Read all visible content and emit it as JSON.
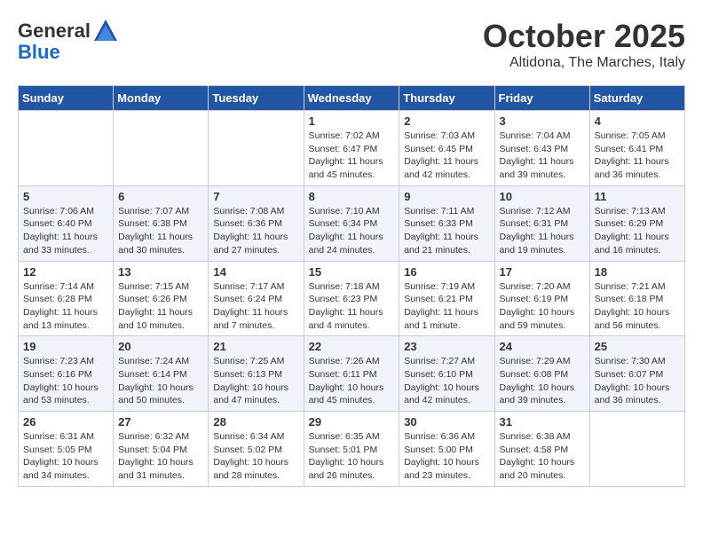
{
  "logo": {
    "general": "General",
    "blue": "Blue"
  },
  "header": {
    "month_year": "October 2025",
    "location": "Altidona, The Marches, Italy"
  },
  "days_of_week": [
    "Sunday",
    "Monday",
    "Tuesday",
    "Wednesday",
    "Thursday",
    "Friday",
    "Saturday"
  ],
  "weeks": [
    [
      {
        "day": "",
        "info": ""
      },
      {
        "day": "",
        "info": ""
      },
      {
        "day": "",
        "info": ""
      },
      {
        "day": "1",
        "info": "Sunrise: 7:02 AM\nSunset: 6:47 PM\nDaylight: 11 hours and 45 minutes."
      },
      {
        "day": "2",
        "info": "Sunrise: 7:03 AM\nSunset: 6:45 PM\nDaylight: 11 hours and 42 minutes."
      },
      {
        "day": "3",
        "info": "Sunrise: 7:04 AM\nSunset: 6:43 PM\nDaylight: 11 hours and 39 minutes."
      },
      {
        "day": "4",
        "info": "Sunrise: 7:05 AM\nSunset: 6:41 PM\nDaylight: 11 hours and 36 minutes."
      }
    ],
    [
      {
        "day": "5",
        "info": "Sunrise: 7:06 AM\nSunset: 6:40 PM\nDaylight: 11 hours and 33 minutes."
      },
      {
        "day": "6",
        "info": "Sunrise: 7:07 AM\nSunset: 6:38 PM\nDaylight: 11 hours and 30 minutes."
      },
      {
        "day": "7",
        "info": "Sunrise: 7:08 AM\nSunset: 6:36 PM\nDaylight: 11 hours and 27 minutes."
      },
      {
        "day": "8",
        "info": "Sunrise: 7:10 AM\nSunset: 6:34 PM\nDaylight: 11 hours and 24 minutes."
      },
      {
        "day": "9",
        "info": "Sunrise: 7:11 AM\nSunset: 6:33 PM\nDaylight: 11 hours and 21 minutes."
      },
      {
        "day": "10",
        "info": "Sunrise: 7:12 AM\nSunset: 6:31 PM\nDaylight: 11 hours and 19 minutes."
      },
      {
        "day": "11",
        "info": "Sunrise: 7:13 AM\nSunset: 6:29 PM\nDaylight: 11 hours and 16 minutes."
      }
    ],
    [
      {
        "day": "12",
        "info": "Sunrise: 7:14 AM\nSunset: 6:28 PM\nDaylight: 11 hours and 13 minutes."
      },
      {
        "day": "13",
        "info": "Sunrise: 7:15 AM\nSunset: 6:26 PM\nDaylight: 11 hours and 10 minutes."
      },
      {
        "day": "14",
        "info": "Sunrise: 7:17 AM\nSunset: 6:24 PM\nDaylight: 11 hours and 7 minutes."
      },
      {
        "day": "15",
        "info": "Sunrise: 7:18 AM\nSunset: 6:23 PM\nDaylight: 11 hours and 4 minutes."
      },
      {
        "day": "16",
        "info": "Sunrise: 7:19 AM\nSunset: 6:21 PM\nDaylight: 11 hours and 1 minute."
      },
      {
        "day": "17",
        "info": "Sunrise: 7:20 AM\nSunset: 6:19 PM\nDaylight: 10 hours and 59 minutes."
      },
      {
        "day": "18",
        "info": "Sunrise: 7:21 AM\nSunset: 6:18 PM\nDaylight: 10 hours and 56 minutes."
      }
    ],
    [
      {
        "day": "19",
        "info": "Sunrise: 7:23 AM\nSunset: 6:16 PM\nDaylight: 10 hours and 53 minutes."
      },
      {
        "day": "20",
        "info": "Sunrise: 7:24 AM\nSunset: 6:14 PM\nDaylight: 10 hours and 50 minutes."
      },
      {
        "day": "21",
        "info": "Sunrise: 7:25 AM\nSunset: 6:13 PM\nDaylight: 10 hours and 47 minutes."
      },
      {
        "day": "22",
        "info": "Sunrise: 7:26 AM\nSunset: 6:11 PM\nDaylight: 10 hours and 45 minutes."
      },
      {
        "day": "23",
        "info": "Sunrise: 7:27 AM\nSunset: 6:10 PM\nDaylight: 10 hours and 42 minutes."
      },
      {
        "day": "24",
        "info": "Sunrise: 7:29 AM\nSunset: 6:08 PM\nDaylight: 10 hours and 39 minutes."
      },
      {
        "day": "25",
        "info": "Sunrise: 7:30 AM\nSunset: 6:07 PM\nDaylight: 10 hours and 36 minutes."
      }
    ],
    [
      {
        "day": "26",
        "info": "Sunrise: 6:31 AM\nSunset: 5:05 PM\nDaylight: 10 hours and 34 minutes."
      },
      {
        "day": "27",
        "info": "Sunrise: 6:32 AM\nSunset: 5:04 PM\nDaylight: 10 hours and 31 minutes."
      },
      {
        "day": "28",
        "info": "Sunrise: 6:34 AM\nSunset: 5:02 PM\nDaylight: 10 hours and 28 minutes."
      },
      {
        "day": "29",
        "info": "Sunrise: 6:35 AM\nSunset: 5:01 PM\nDaylight: 10 hours and 26 minutes."
      },
      {
        "day": "30",
        "info": "Sunrise: 6:36 AM\nSunset: 5:00 PM\nDaylight: 10 hours and 23 minutes."
      },
      {
        "day": "31",
        "info": "Sunrise: 6:38 AM\nSunset: 4:58 PM\nDaylight: 10 hours and 20 minutes."
      },
      {
        "day": "",
        "info": ""
      }
    ]
  ]
}
